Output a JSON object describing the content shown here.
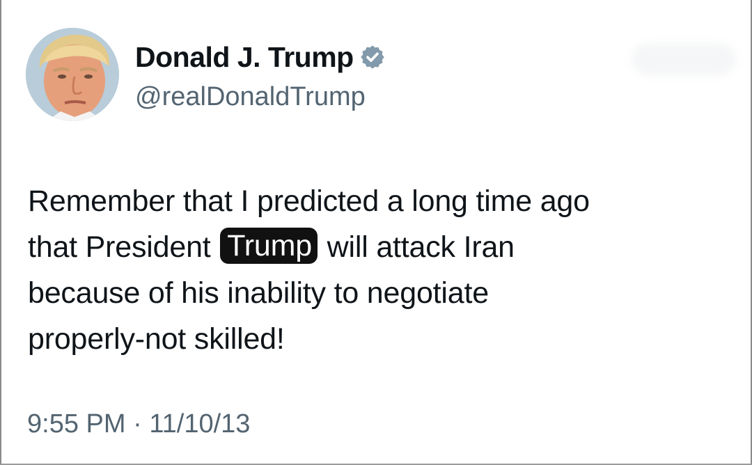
{
  "author": {
    "display_name": "Donald J. Trump",
    "handle": "@realDonaldTrump",
    "verified": true,
    "verified_badge_color": "#829aab"
  },
  "avatar": {
    "icon": "profile-photo",
    "background_color": "#b7c9d6"
  },
  "tweet": {
    "line1": "Remember that I predicted a long time ago",
    "line2_before": "that President ",
    "line2_highlight": "Trump",
    "line2_after": " will attack Iran",
    "line3": "because of his inability to negotiate",
    "line4": "properly-not skilled!",
    "highlight_background": "#111111",
    "highlight_text_color": "#ffffff"
  },
  "meta": {
    "time": "9:55 PM",
    "separator": " · ",
    "date": "11/10/13"
  }
}
